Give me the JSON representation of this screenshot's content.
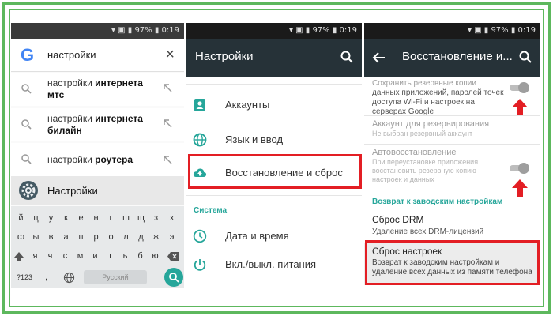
{
  "panel1": {
    "status_right": "▾ ▣ ▮ 97% ▮ 0:19",
    "search": {
      "logo": "G",
      "query": "настройки",
      "close": "×"
    },
    "suggestions": [
      {
        "prefix": "настройки ",
        "bold": "интернета мтс"
      },
      {
        "prefix": "настройки ",
        "bold": "интернета билайн"
      },
      {
        "prefix": "настройки ",
        "bold": "роутера"
      }
    ],
    "app_result": "Настройки",
    "keyboard": {
      "row1": [
        "й",
        "ц",
        "у",
        "к",
        "е",
        "н",
        "г",
        "ш",
        "щ",
        "з",
        "х"
      ],
      "row2": [
        "ф",
        "ы",
        "в",
        "а",
        "п",
        "р",
        "о",
        "л",
        "д",
        "ж",
        "э"
      ],
      "row3": [
        "я",
        "ч",
        "с",
        "м",
        "и",
        "т",
        "ь",
        "б",
        "ю"
      ],
      "sym": "?123",
      "comma": ",",
      "space": "Русский"
    }
  },
  "panel2": {
    "status_right": "▾ ▣ ▮ 97% ▮ 0:19",
    "title": "Настройки",
    "items_top": [
      "Аккаунты",
      "Язык и ввод",
      "Восстановление и сброс"
    ],
    "section": "Система",
    "items_bottom": [
      "Дата и время",
      "Вкл./выкл. питания"
    ]
  },
  "panel3": {
    "status_right": "▾ ▣ ▮ 97% ▮ 0:19",
    "title": "Восстановление и...",
    "backup": {
      "title": "Сохранить резервные копии",
      "desc": "данных приложений, паролей точек доступа Wi-Fi и настроек на серверах Google"
    },
    "account": {
      "title": "Аккаунт для резервирования",
      "desc": "Не выбран резервный аккаунт"
    },
    "autorestore": {
      "title": "Автовосстановление",
      "desc": "При переустановке приложения восстановить резервную копию настроек и данных"
    },
    "section": "Возврат к заводским настройкам",
    "drm": {
      "title": "Сброс DRM",
      "desc": "Удаление всех DRM-лицензий"
    },
    "factory": {
      "title": "Сброс настроек",
      "desc": "Возврат к заводским настройкам и удаление всех данных из памяти телефона"
    }
  },
  "colors": {
    "frame": "#5db85d",
    "toolbar": "#263238",
    "accent": "#26a69a",
    "highlight": "#e31e24"
  }
}
